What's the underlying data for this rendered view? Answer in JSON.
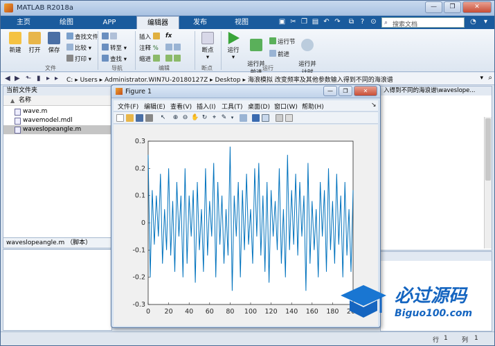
{
  "window": {
    "title": "MATLAB R2018a"
  },
  "ribbon_tabs": [
    {
      "label": "主页"
    },
    {
      "label": "绘图"
    },
    {
      "label": "APP"
    },
    {
      "label": "编辑器"
    },
    {
      "label": "发布"
    },
    {
      "label": "视图"
    }
  ],
  "search": {
    "placeholder": "搜索文档"
  },
  "ribbon": {
    "file_group": {
      "label": "文件",
      "new": "新建",
      "open": "打开",
      "save": "保存",
      "find_files": "查找文件",
      "compare": "比较",
      "print": "打印"
    },
    "nav_group": {
      "label": "导航",
      "goto": "转至",
      "find": "查找"
    },
    "edit_group": {
      "label": "编辑",
      "insert": "插入",
      "comment": "注释",
      "indent": "缩进",
      "fx": "fx"
    },
    "breakpoint_group": {
      "label": "断点",
      "breakpoints": "断点"
    },
    "run_group": {
      "label": "运行",
      "run": "运行",
      "run_advance": "运行并\n前进",
      "run_section": "运行节",
      "advance": "前进",
      "run_time": "运行并\n计时"
    }
  },
  "address": {
    "segments": [
      "C:",
      "Users",
      "Administrator.WIN7U-20180127Z",
      "Desktop",
      "海浪模拟 改变频率及其他参数输入得到不同的海浪谱"
    ]
  },
  "current_folder": {
    "title": "当前文件夹",
    "column": "名称",
    "files": [
      {
        "name": "wave.m",
        "selected": false
      },
      {
        "name": "wavemodel.mdl",
        "selected": false
      },
      {
        "name": "waveslopeangle.m",
        "selected": true
      }
    ],
    "detail": "waveslopeangle.m （脚本）"
  },
  "editor": {
    "tab_text": "入得到不同的海浪谱\\waveslope..."
  },
  "status_bar": {
    "row_label": "行",
    "row_value": "1",
    "col_label": "列",
    "col_value": "1"
  },
  "figure": {
    "title": "Figure 1",
    "menus": [
      "文件(F)",
      "编辑(E)",
      "查看(V)",
      "插入(I)",
      "工具(T)",
      "桌面(D)",
      "窗口(W)",
      "帮助(H)"
    ]
  },
  "chart_data": {
    "type": "line",
    "title": "",
    "xlabel": "",
    "ylabel": "",
    "xlim": [
      0,
      200
    ],
    "ylim": [
      -0.3,
      0.3
    ],
    "xticks": [
      0,
      20,
      40,
      60,
      80,
      100,
      120,
      140,
      160,
      180,
      200
    ],
    "yticks": [
      -0.3,
      -0.2,
      -0.1,
      0,
      0.1,
      0.2,
      0.3
    ],
    "ytick_labels": [
      "-0.3",
      "-0.2",
      "-0.1",
      "0",
      "0.1",
      "0.2",
      "0.3"
    ],
    "color": "#0072bd",
    "series": [
      {
        "x": [
          0,
          2,
          4,
          6,
          8,
          10,
          12,
          14,
          16,
          18,
          20,
          22,
          24,
          26,
          28,
          30,
          32,
          34,
          36,
          38,
          40,
          42,
          44,
          46,
          48,
          50,
          52,
          54,
          56,
          58,
          60,
          62,
          64,
          66,
          68,
          70,
          72,
          74,
          76,
          78,
          80,
          82,
          84,
          86,
          88,
          90,
          92,
          94,
          96,
          98,
          100,
          102,
          104,
          106,
          108,
          110,
          112,
          114,
          116,
          118,
          120,
          122,
          124,
          126,
          128,
          130,
          132,
          134,
          136,
          138,
          140,
          142,
          144,
          146,
          148,
          150,
          152,
          154,
          156,
          158,
          160,
          162,
          164,
          166,
          168,
          170,
          172,
          174,
          176,
          178,
          180,
          182,
          184,
          186,
          188,
          190,
          192,
          194,
          196,
          198,
          200
        ],
        "y": [
          0.25,
          -0.2,
          0.12,
          -0.08,
          0.1,
          -0.05,
          0.18,
          -0.15,
          0.05,
          -0.1,
          0.2,
          -0.12,
          0.08,
          -0.18,
          0.15,
          -0.05,
          0.1,
          -0.2,
          0.2,
          -0.15,
          0.1,
          -0.05,
          0.12,
          -0.22,
          0.15,
          -0.1,
          0.05,
          -0.18,
          0.2,
          -0.12,
          0.08,
          -0.05,
          0.22,
          -0.2,
          0.15,
          -0.08,
          0.1,
          -0.15,
          0.05,
          -0.12,
          0.28,
          -0.25,
          0.1,
          -0.05,
          0.15,
          -0.2,
          0.12,
          -0.1,
          0.18,
          -0.08,
          0.05,
          -0.15,
          0.2,
          -0.05,
          0.22,
          -0.12,
          0.1,
          -0.18,
          0.15,
          -0.22,
          0.12,
          -0.05,
          0.08,
          -0.1,
          0.2,
          -0.15,
          0.05,
          -0.2,
          0.25,
          -0.1,
          0.12,
          -0.08,
          0.18,
          -0.12,
          0.15,
          -0.05,
          0.1,
          -0.25,
          0.22,
          -0.15,
          0.08,
          -0.1,
          0.05,
          -0.2,
          0.15,
          -0.05,
          0.12,
          -0.18,
          0.2,
          -0.1,
          0.08,
          -0.15,
          0.18,
          -0.08,
          0.1,
          -0.2,
          0.15,
          -0.12,
          0.05,
          -0.18,
          0.12
        ]
      }
    ]
  },
  "watermark": {
    "cn": "必过源码",
    "en": "Biguo100.com"
  }
}
